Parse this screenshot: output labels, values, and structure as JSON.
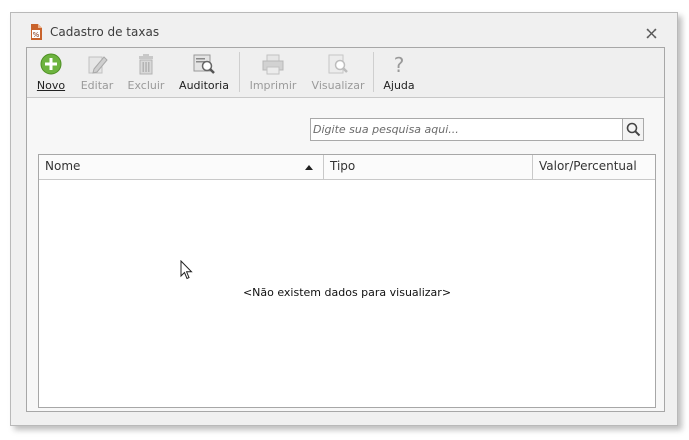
{
  "window": {
    "title": "Cadastro de taxas",
    "close_icon": "close-icon",
    "title_icon": "percent-document-icon"
  },
  "toolbar": {
    "buttons": [
      {
        "label": "Novo",
        "mnemonic": "N",
        "icon": "add-circle-icon",
        "enabled": true
      },
      {
        "label": "Editar",
        "mnemonic": "E",
        "icon": "pencil-icon",
        "enabled": false
      },
      {
        "label": "Excluir",
        "mnemonic": "E",
        "icon": "trash-icon",
        "enabled": false
      },
      {
        "label": "Auditoria",
        "mnemonic": "u",
        "icon": "audit-magnifier-icon",
        "enabled": true
      },
      {
        "label": "Imprimir",
        "mnemonic": "p",
        "icon": "printer-icon",
        "enabled": false
      },
      {
        "label": "Visualizar",
        "mnemonic": "V",
        "icon": "preview-icon",
        "enabled": false
      },
      {
        "label": "Ajuda",
        "mnemonic": "A",
        "icon": "help-question-icon",
        "enabled": true
      }
    ]
  },
  "search": {
    "placeholder": "Digite sua pesquisa aqui...",
    "value": "",
    "button_icon": "search-icon"
  },
  "grid": {
    "columns": [
      "Nome",
      "Tipo",
      "Valor/Percentual"
    ],
    "sort_column": "Nome",
    "sort_direction": "ascending",
    "empty_message": "<Não existem dados para visualizar>",
    "rows": []
  },
  "colors": {
    "accent_green": "#6db33f",
    "disabled_text": "#9a9a9a",
    "window_background": "#f0f0f0"
  }
}
